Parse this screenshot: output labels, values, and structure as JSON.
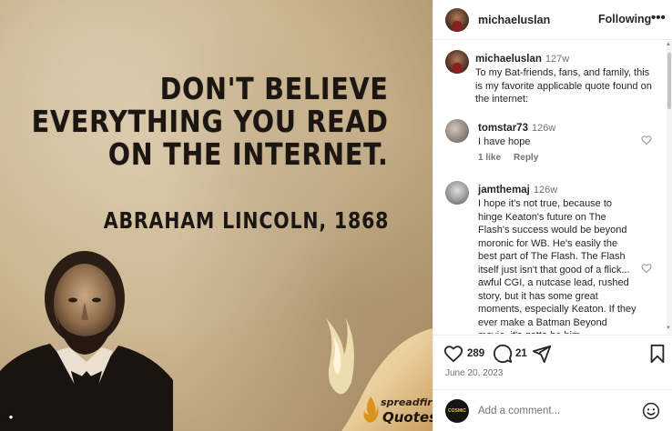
{
  "post_image": {
    "quote_lines": [
      "DON'T BELIEVE",
      "EVERYTHING YOU READ",
      "ON THE INTERNET."
    ],
    "attribution": "ABRAHAM LINCOLN, 1868",
    "brand_top": "spreadfire",
    "brand_bottom": "Quotes"
  },
  "header": {
    "username": "michaeluslan",
    "follow_label": "Following",
    "more_icon": "more-options-icon"
  },
  "caption": {
    "username": "michaeluslan",
    "time": "127w",
    "text": "To my Bat-friends, fans, and family, this is my favorite applicable quote found on the internet:"
  },
  "comments": [
    {
      "username": "tomstar73",
      "time": "126w",
      "text": "I have hope",
      "likes_label": "1 like",
      "reply_label": "Reply"
    },
    {
      "username": "jamthemaj",
      "time": "126w",
      "text": "I hope it's not true, because to hinge Keaton's future on The Flash's success would be beyond moronic for WB. He's easily the best part of The Flash. The Flash itself just isn't that good of a flick... awful CGI, a nutcase lead, rushed story, but it has some great moments, especially Keaton. If they ever make a Batman Beyond movie, it's gotta be him."
    }
  ],
  "actions": {
    "like_count": "289",
    "comment_count": "21",
    "date": "June 20, 2023"
  },
  "add_comment": {
    "placeholder": "Add a comment...",
    "avatar_text": "COSMIC"
  },
  "colors": {
    "text_primary": "#262626",
    "text_secondary": "#737373",
    "divider": "#efefef"
  }
}
